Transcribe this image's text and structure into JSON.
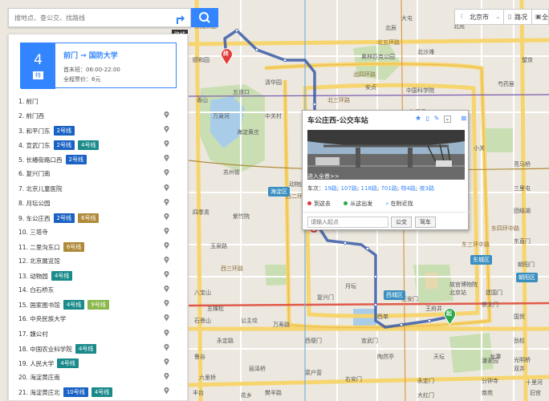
{
  "search": {
    "placeholder": "搜地点、查公交、找路线",
    "route_tooltip": "路线"
  },
  "route": {
    "number": "4",
    "unit": "特",
    "name": "前门 → 国防大学",
    "hours": "首末班：06:00-22:00",
    "fare": "全程票价：6元"
  },
  "stops": [
    {
      "label": "1. 前门",
      "chips": [],
      "pin": false
    },
    {
      "label": "2. 前门西",
      "chips": [],
      "pin": true
    },
    {
      "label": "3. 和平门东",
      "chips": [
        {
          "text": "2号线",
          "color": "#1a62c4"
        }
      ],
      "pin": true
    },
    {
      "label": "4. 宣武门东",
      "chips": [
        {
          "text": "2号线",
          "color": "#1a62c4"
        },
        {
          "text": "4号线",
          "color": "#1a8a8a"
        }
      ],
      "pin": true
    },
    {
      "label": "5. 长椿街路口西",
      "chips": [
        {
          "text": "2号线",
          "color": "#1a62c4"
        }
      ],
      "pin": true
    },
    {
      "label": "6. 复兴门南",
      "chips": [],
      "pin": true
    },
    {
      "label": "7. 北京儿童医院",
      "chips": [],
      "pin": true
    },
    {
      "label": "8. 月坛公园",
      "chips": [],
      "pin": true
    },
    {
      "label": "9. 车公庄西",
      "chips": [
        {
          "text": "2号线",
          "color": "#1a62c4"
        },
        {
          "text": "6号线",
          "color": "#b08a3a"
        }
      ],
      "pin": true
    },
    {
      "label": "10. 三塔寺",
      "chips": [],
      "pin": true
    },
    {
      "label": "11. 二里沟东口",
      "chips": [
        {
          "text": "6号线",
          "color": "#b08a3a"
        }
      ],
      "pin": true
    },
    {
      "label": "12. 北京展览馆",
      "chips": [],
      "pin": true
    },
    {
      "label": "13. 动物园",
      "chips": [
        {
          "text": "4号线",
          "color": "#1a8a8a"
        }
      ],
      "pin": true
    },
    {
      "label": "14. 白石桥东",
      "chips": [],
      "pin": true
    },
    {
      "label": "15. 国家图书馆",
      "chips": [
        {
          "text": "4号线",
          "color": "#1a8a8a"
        },
        {
          "text": "9号线",
          "color": "#8ab84a"
        }
      ],
      "pin": true
    },
    {
      "label": "16. 中央民族大学",
      "chips": [],
      "pin": true
    },
    {
      "label": "17. 魏公村",
      "chips": [],
      "pin": true
    },
    {
      "label": "18. 中国农业科学院",
      "chips": [
        {
          "text": "4号线",
          "color": "#1a8a8a"
        }
      ],
      "pin": true
    },
    {
      "label": "19. 人民大学",
      "chips": [
        {
          "text": "4号线",
          "color": "#1a8a8a"
        }
      ],
      "pin": true
    },
    {
      "label": "20. 海淀黄庄南",
      "chips": [],
      "pin": true
    },
    {
      "label": "21. 海淀黄庄北",
      "chips": [
        {
          "text": "10号线",
          "color": "#1a62c4"
        },
        {
          "text": "4号线",
          "color": "#1a8a8a"
        }
      ],
      "pin": true
    }
  ],
  "controls": {
    "city": "北京市",
    "traffic": "路况",
    "full": "全"
  },
  "popup": {
    "title": "车公庄西-公交车站",
    "panorama": "进入全景>>",
    "lines_prefix": "车次：",
    "lines": [
      "19路",
      "107路",
      "118路",
      "701路",
      "特4路",
      "夜3路"
    ],
    "actions": [
      "到这去",
      "从这出发",
      "在附近找"
    ],
    "start_placeholder": "请输入起点",
    "bus_btn": "公交",
    "drive_btn": "驾车"
  },
  "map": {
    "labels": [
      "北五环路",
      "北四环路",
      "北三环路",
      "北二环路",
      "东四环中路",
      "东三环中路",
      "西二环路",
      "西三环路",
      "京藏高速",
      "北苑",
      "北辰",
      "中国科学院",
      "奥林匹克公园",
      "小关",
      "安贞",
      "和平里",
      "雍和宫",
      "东直门",
      "北京站",
      "崇文门",
      "天安门",
      "故宫博物院",
      "王府井",
      "西单",
      "宣武门",
      "西便门",
      "复兴门",
      "月坛",
      "西直门",
      "动物园",
      "紫竹院",
      "八宝山",
      "五棵松",
      "公主坟",
      "永定路",
      "鲁谷",
      "石景山",
      "万寿路",
      "六里桥",
      "丽泽桥",
      "菜户营",
      "右安门",
      "陶然亭",
      "天坛",
      "永定门",
      "龙潭",
      "劲松",
      "双井",
      "国贸",
      "建国门",
      "朝阳门",
      "团结湖",
      "三里屯",
      "亮马桥",
      "芍药居",
      "望京",
      "大屯",
      "北沙滩",
      "学院路",
      "五道口",
      "清华园",
      "中关村",
      "海淀黄庄",
      "苏州街",
      "万泉河",
      "颐和园",
      "香山",
      "四季青",
      "玉泉路",
      "旧宫",
      "南苑",
      "光明桥",
      "潘家园",
      "十里河",
      "分钟寺",
      "大红门",
      "花乡",
      "丰台",
      "樊羊路"
    ],
    "districts": [
      "海淀区",
      "西城区",
      "东城区",
      "朝阳区"
    ],
    "markers": {
      "start": "起",
      "end": "终"
    }
  }
}
